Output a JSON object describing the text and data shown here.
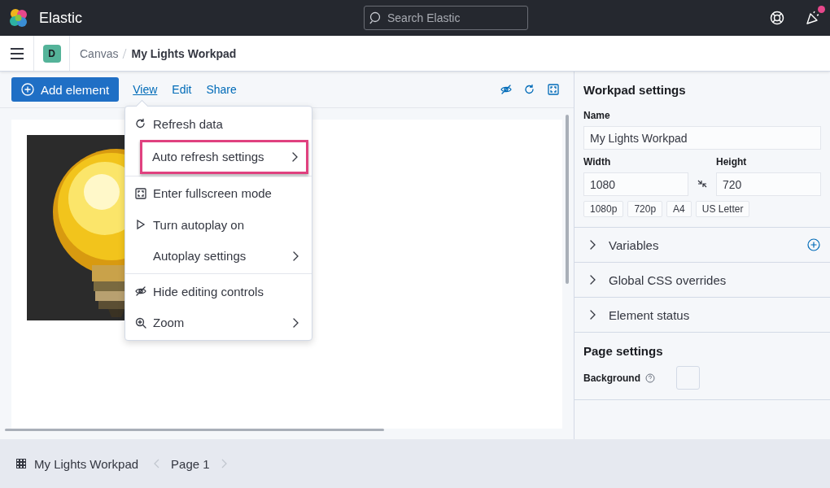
{
  "header": {
    "brand": "Elastic",
    "search": {
      "placeholder": "Search Elastic"
    },
    "notification": true
  },
  "breadcrumbs": {
    "space": "D",
    "items": [
      {
        "label": "Canvas",
        "current": false
      },
      {
        "label": "My Lights Workpad",
        "current": true
      }
    ]
  },
  "toolbar": {
    "add_button": "Add element",
    "tabs": [
      {
        "label": "View",
        "selected": true
      },
      {
        "label": "Edit",
        "selected": false
      },
      {
        "label": "Share",
        "selected": false
      }
    ]
  },
  "menu": {
    "groups": [
      [
        {
          "label": "Refresh data",
          "submenu": false,
          "highlighted": false
        },
        {
          "label": "Auto refresh settings",
          "submenu": true,
          "highlighted": true
        }
      ],
      [
        {
          "label": "Enter fullscreen mode",
          "submenu": false,
          "highlighted": false
        },
        {
          "label": "Turn autoplay on",
          "submenu": false,
          "highlighted": false
        },
        {
          "label": "Autoplay settings",
          "submenu": true,
          "highlighted": false
        }
      ],
      [
        {
          "label": "Hide editing controls",
          "submenu": false,
          "highlighted": false
        },
        {
          "label": "Zoom",
          "submenu": true,
          "highlighted": false
        }
      ]
    ]
  },
  "workpad_settings": {
    "title": "Workpad settings",
    "name_label": "Name",
    "name_value": "My Lights Workpad",
    "width_label": "Width",
    "width_value": "1080",
    "height_label": "Height",
    "height_value": "720",
    "presets": [
      "1080p",
      "720p",
      "A4",
      "US Letter"
    ],
    "sections": [
      {
        "label": "Variables",
        "expanded": false,
        "add": true
      },
      {
        "label": "Global CSS overrides",
        "expanded": false,
        "add": false
      },
      {
        "label": "Element status",
        "expanded": false,
        "add": false
      }
    ]
  },
  "page_settings": {
    "title": "Page settings",
    "background_label": "Background"
  },
  "footer": {
    "workpad": "My Lights Workpad",
    "page": "Page 1"
  }
}
